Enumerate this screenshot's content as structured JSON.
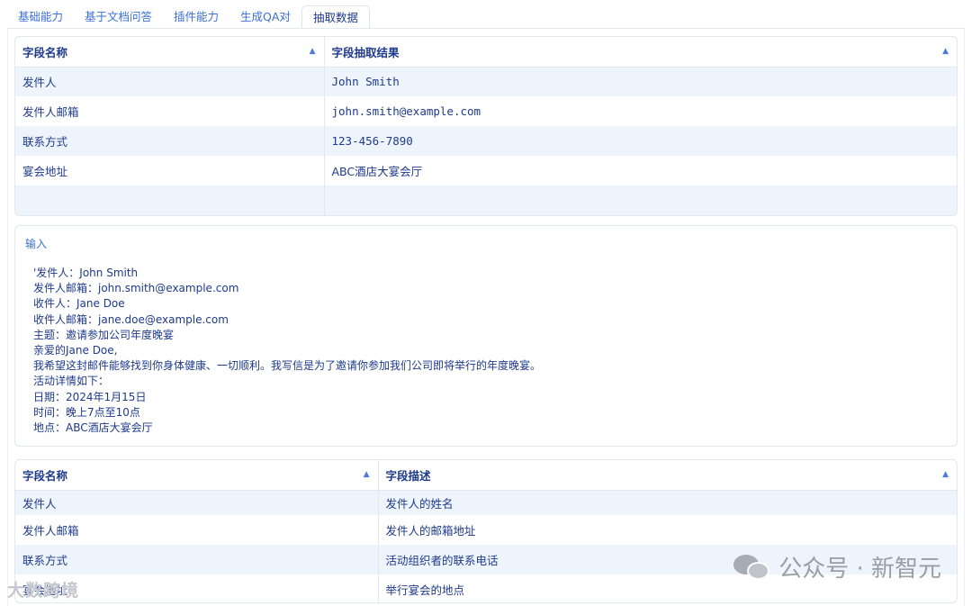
{
  "tabs": [
    "基础能力",
    "基于文档问答",
    "插件能力",
    "生成QA对",
    "抽取数据"
  ],
  "active_tab": 4,
  "result_table": {
    "headers": [
      "字段名称",
      "字段抽取结果"
    ],
    "rows": [
      [
        "发件人",
        "John Smith"
      ],
      [
        "发件人邮箱",
        "john.smith@example.com"
      ],
      [
        "联系方式",
        "123-456-7890"
      ],
      [
        "宴会地址",
        "ABC酒店大宴会厅"
      ],
      [
        "",
        ""
      ]
    ]
  },
  "input": {
    "label": "输入",
    "text": "'发件人：John Smith\n发件人邮箱：john.smith@example.com\n收件人：Jane Doe\n收件人邮箱：jane.doe@example.com\n主题：邀请参加公司年度晚宴\n亲爱的Jane Doe,\n我希望这封邮件能够找到你身体健康、一切顺利。我写信是为了邀请你参加我们公司即将举行的年度晚宴。\n活动详情如下：\n日期：2024年1月15日\n时间：晚上7点至10点\n地点：ABC酒店大宴会厅"
  },
  "desc_table": {
    "headers": [
      "字段名称",
      "字段描述"
    ],
    "rows": [
      [
        "发件人",
        "发件人的姓名"
      ],
      [
        "发件人邮箱",
        "发件人的邮箱地址"
      ],
      [
        "联系方式",
        "活动组织者的联系电话"
      ],
      [
        "宴会地址",
        "举行宴会的地点"
      ]
    ]
  },
  "watermark": {
    "main": "公众号 · 新智元",
    "corner": "大数跨境"
  },
  "icons": {
    "sort": "sort-ascending-icon",
    "wechat": "wechat-icon"
  }
}
